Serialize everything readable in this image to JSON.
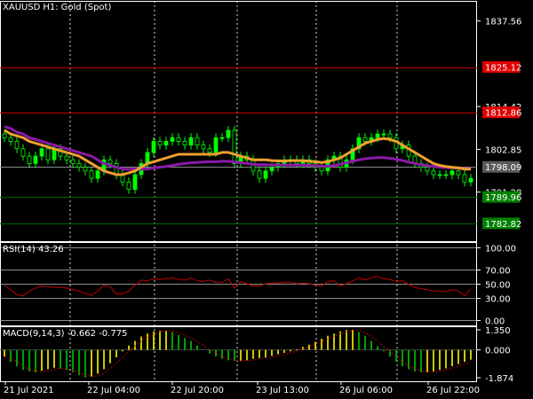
{
  "main": {
    "symbol": "XAUUSD",
    "timeframe": "H1:",
    "description": "Gold (Spot)",
    "price_axis_labels": [
      "1837.56",
      "1814.42",
      "1802.85",
      "1791.28"
    ],
    "levels": [
      {
        "label": "1825.12",
        "value": 1825.12,
        "line_color": "#c00000",
        "tag_color": "#e00000"
      },
      {
        "label": "1812.86",
        "value": 1812.86,
        "line_color": "#c00000",
        "tag_color": "#e00000"
      },
      {
        "label": "1798.09",
        "value": 1798.09,
        "line_color": "#8a8a8a",
        "tag_color": "#5a5a5a"
      },
      {
        "label": "1789.96",
        "value": 1789.96,
        "line_color": "#006400",
        "tag_color": "#008000"
      },
      {
        "label": "1782.82",
        "value": 1782.82,
        "line_color": "#006400",
        "tag_color": "#008000"
      }
    ]
  },
  "rsi": {
    "title": "RSI(14) 43.26",
    "axis_labels": [
      "100.00",
      "70.00",
      "50.00",
      "30.00",
      "0.00"
    ],
    "levels": [
      100,
      70,
      50,
      30,
      0
    ]
  },
  "macd": {
    "title": "MACD(9,14,3) -0.662 -0.775",
    "axis_labels": [
      "1.350",
      "0.000",
      "-1.874"
    ]
  },
  "time_axis_labels": [
    "21 Jul 2021",
    "22 Jul 04:00",
    "22 Jul 20:00",
    "23 Jul 13:00",
    "26 Jul 06:00",
    "26 Jul 22:00"
  ],
  "colors": {
    "background": "#000000",
    "grid": "#ffffff",
    "bull_candle": "#00ff00",
    "bear_candle": "#000000",
    "candle_wick": "#00ff00",
    "ma_fast": "#f0a030",
    "ma_slow": "#8b1aa8",
    "rsi_line": "#c00000",
    "macd_hist_bull": "#c8c800",
    "macd_hist_bear": "#00a000",
    "macd_signal": "#c00000"
  },
  "chart_data": {
    "type": "line",
    "candles_close": [
      1806,
      1805,
      1803,
      1801,
      1799,
      1801,
      1803,
      1800,
      1803,
      1801,
      1800,
      1799,
      1798,
      1797,
      1795,
      1797,
      1800,
      1799,
      1796,
      1794,
      1792,
      1796,
      1799,
      1802,
      1805,
      1804,
      1805,
      1806,
      1805,
      1804,
      1806,
      1804,
      1803,
      1802,
      1806,
      1806,
      1808,
      1799,
      1801,
      1800,
      1797,
      1795,
      1797,
      1798,
      1799,
      1800,
      1800,
      1799,
      1800,
      1799,
      1798,
      1797,
      1800,
      1801,
      1798,
      1800,
      1803,
      1806,
      1805,
      1806,
      1807,
      1807,
      1806,
      1803,
      1804,
      1801,
      1799,
      1798,
      1797,
      1796,
      1796,
      1796,
      1797,
      1796,
      1794,
      1795
    ],
    "ma_fast": [
      1808,
      1807,
      1806.5,
      1806,
      1805,
      1804.5,
      1804,
      1803.5,
      1803,
      1802.5,
      1802,
      1801.5,
      1801,
      1800,
      1799,
      1798,
      1797,
      1796.5,
      1796,
      1796,
      1796.5,
      1797,
      1798,
      1799,
      1799.5,
      1800,
      1800.5,
      1801,
      1801.5,
      1801.5,
      1801.5,
      1801.5,
      1801.5,
      1801.5,
      1801.5,
      1802,
      1802,
      1801.5,
      1801,
      1800.5,
      1800,
      1800,
      1800,
      1799.8,
      1799.7,
      1799.7,
      1799.8,
      1799.8,
      1799.8,
      1799.6,
      1799.5,
      1799.3,
      1799.5,
      1800,
      1800.5,
      1801.5,
      1802.5,
      1803.5,
      1804.5,
      1805,
      1805.5,
      1805.8,
      1805.5,
      1805,
      1804,
      1803,
      1802,
      1801,
      1800,
      1799,
      1798.5,
      1798.2,
      1798,
      1797.8,
      1797.5,
      1797.5
    ],
    "ma_slow": [
      1809,
      1808.5,
      1807.5,
      1807,
      1806,
      1805.5,
      1805,
      1804.5,
      1804,
      1803.5,
      1803,
      1802.5,
      1802,
      1801.5,
      1801,
      1800,
      1799,
      1798.5,
      1798,
      1797.5,
      1797.5,
      1797.5,
      1797.5,
      1797.5,
      1797.8,
      1798,
      1798.2,
      1798.5,
      1798.8,
      1799,
      1799.2,
      1799.3,
      1799.4,
      1799.5,
      1799.5,
      1799.6,
      1799.6,
      1799.4,
      1799.2,
      1799,
      1798.8,
      1798.7,
      1798.7,
      1798.6,
      1798.6,
      1798.6,
      1798.6,
      1798.6,
      1798.6,
      1798.5,
      1798.4,
      1798.3,
      1798.3,
      1798.5,
      1798.8,
      1799.2,
      1799.6,
      1800,
      1800.3,
      1800.5,
      1800.6,
      1800.6,
      1800.4,
      1800.2,
      1799.8,
      1799.4,
      1799,
      1798.7,
      1798.4,
      1798.2,
      1798,
      1797.9,
      1797.8,
      1797.7,
      1797.6,
      1797.6
    ],
    "rsi": [
      48,
      42,
      35,
      33,
      40,
      44,
      47,
      46,
      45,
      45,
      44,
      42,
      40,
      37,
      34,
      40,
      48,
      46,
      36,
      36,
      40,
      48,
      55,
      54,
      57,
      56,
      57,
      58,
      56,
      55,
      58,
      54,
      53,
      55,
      52,
      52,
      57,
      44,
      53,
      50,
      47,
      47,
      50,
      51,
      51,
      52,
      52,
      50,
      51,
      50,
      48,
      47,
      53,
      54,
      47,
      50,
      54,
      58,
      55,
      58,
      60,
      57,
      56,
      53,
      54,
      49,
      45,
      43,
      42,
      40,
      40,
      39,
      42,
      40,
      33,
      43
    ],
    "macd": [
      -0.45,
      -0.8,
      -1.1,
      -1.35,
      -1.45,
      -1.5,
      -1.4,
      -1.3,
      -1.2,
      -1.25,
      -1.35,
      -1.5,
      -1.7,
      -1.85,
      -1.8,
      -1.6,
      -1.3,
      -0.9,
      -0.5,
      -0.1,
      0.3,
      0.6,
      0.9,
      1.1,
      1.25,
      1.3,
      1.3,
      1.2,
      1.0,
      0.8,
      0.6,
      0.3,
      0.0,
      -0.25,
      -0.45,
      -0.6,
      -0.7,
      -0.75,
      -0.75,
      -0.7,
      -0.6,
      -0.55,
      -0.5,
      -0.4,
      -0.3,
      -0.2,
      -0.1,
      0.05,
      0.2,
      0.35,
      0.55,
      0.75,
      0.95,
      1.1,
      1.25,
      1.35,
      1.35,
      1.2,
      0.95,
      0.6,
      0.25,
      -0.1,
      -0.45,
      -0.8,
      -1.1,
      -1.3,
      -1.45,
      -1.5,
      -1.5,
      -1.45,
      -1.35,
      -1.25,
      -1.1,
      -0.95,
      -0.8,
      -0.66
    ],
    "price_ylim": [
      1778,
      1843
    ],
    "rsi_ylim": [
      0,
      100
    ],
    "macd_ylim": [
      -1.874,
      1.35
    ]
  }
}
